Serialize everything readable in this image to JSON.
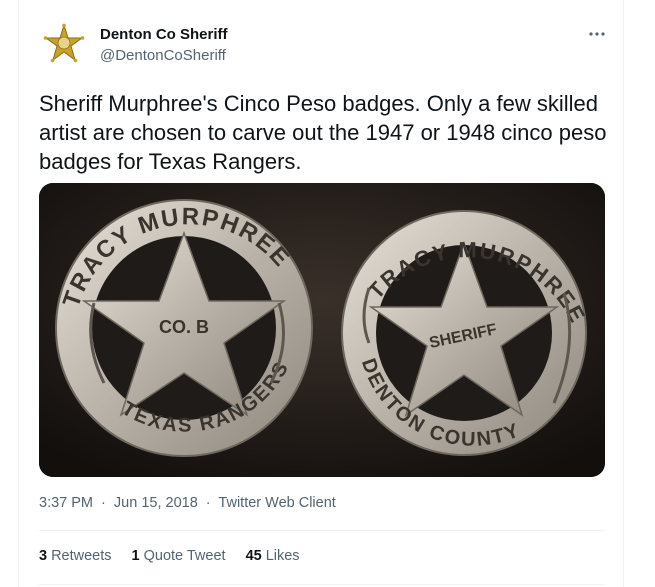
{
  "account": {
    "display_name": "Denton Co Sheriff",
    "handle": "@DentonCoSheriff",
    "avatar_icon": "sheriff-star-badge-icon"
  },
  "more_icon": "more-dots-icon",
  "tweet": {
    "text": "Sheriff Murphree's Cinco Peso badges.  Only a few skilled artist are chosen to carve out the 1947 or 1948 cinco peso badges for Texas Rangers."
  },
  "media": {
    "badge_left": {
      "ring_top": "TRACY MURPHREE",
      "ring_bottom": "TEXAS RANGERS",
      "star_text": "CO. B"
    },
    "badge_right": {
      "ring_top": "TRACY MURPHREE",
      "ring_bottom": "DENTON COUNTY",
      "star_text": "SHERIFF"
    }
  },
  "meta": {
    "time": "3:37 PM",
    "separator": "·",
    "date": "Jun 15, 2018",
    "client": "Twitter Web Client"
  },
  "stats": {
    "retweets_count": "3",
    "retweets_label": "Retweets",
    "quote_count": "1",
    "quote_label": "Quote Tweet",
    "likes_count": "45",
    "likes_label": "Likes"
  },
  "colors": {
    "text_primary": "#0f1419",
    "text_secondary": "#536471",
    "divider": "#eff3f4",
    "badge_silver": "#c9c3bb"
  }
}
